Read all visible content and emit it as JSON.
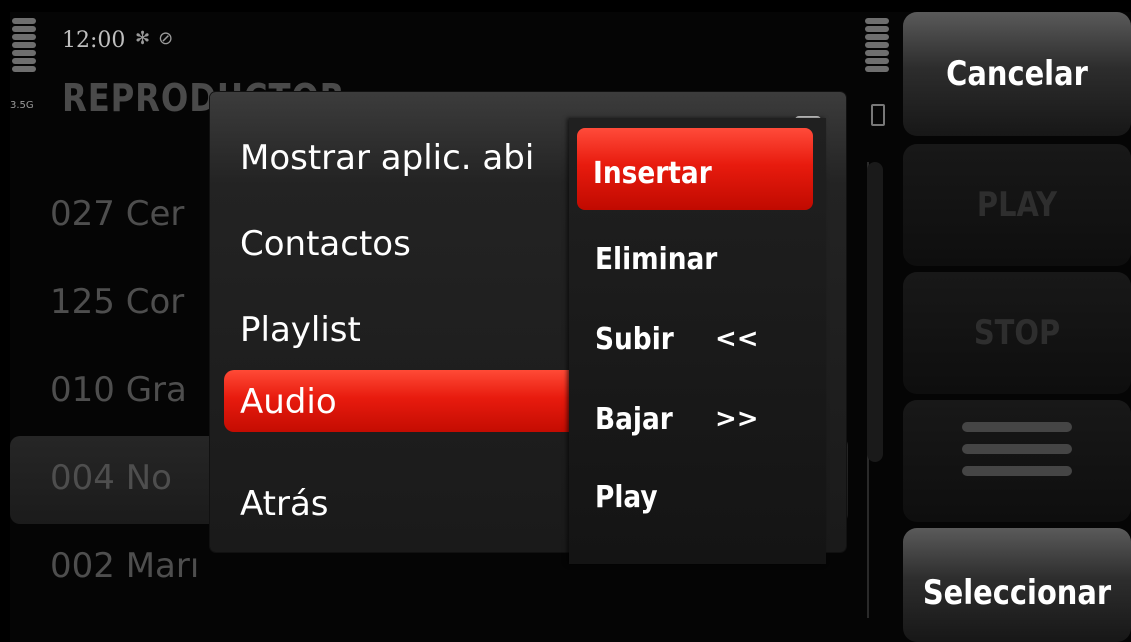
{
  "status": {
    "network": "3.5G",
    "time": "12:00",
    "icons": [
      "bluetooth-icon",
      "alarm-icon"
    ]
  },
  "app": {
    "title": "REPRODUCTOR"
  },
  "background_list": [
    {
      "text": "027  Cer"
    },
    {
      "text": "125  Cor"
    },
    {
      "text": "010  Gra"
    },
    {
      "text": "004  No"
    },
    {
      "text": "002  Marı"
    }
  ],
  "popup_menu": {
    "items": [
      {
        "label": "Mostrar aplic. abi"
      },
      {
        "label": "Contactos"
      },
      {
        "label": "Playlist"
      },
      {
        "label": "Audio",
        "selected": true
      },
      {
        "label": "Atrás"
      }
    ]
  },
  "submenu": {
    "items": [
      {
        "label": "Insertar",
        "selected": true
      },
      {
        "label": "Eliminar"
      },
      {
        "label": "Subir",
        "arrows": "<<"
      },
      {
        "label": "Bajar",
        "arrows": ">>"
      },
      {
        "label": "Play"
      }
    ]
  },
  "softkeys": {
    "cancel": "Cancelar",
    "play": "PLAY",
    "stop": "STOP",
    "menu_icon": "menu-icon",
    "select": "Seleccionar"
  },
  "colors": {
    "highlight": "#e81b0e",
    "background": "#050505"
  }
}
